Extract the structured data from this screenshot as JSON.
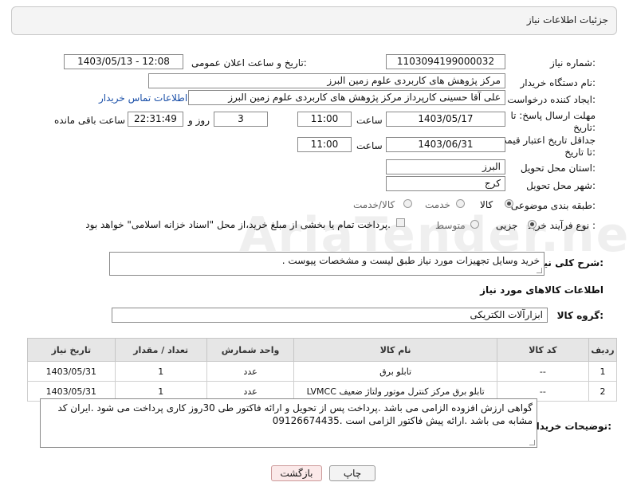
{
  "header": {
    "title": "جزئیات اطلاعات نیاز"
  },
  "watermark": "AriaTender.neT",
  "fields": {
    "need_number_label": "شماره نیاز:",
    "need_number": "1103094199000032",
    "announce_label": "تاریخ و ساعت اعلان عمومی:",
    "announce_value": "1403/05/13 - 12:08",
    "buyer_label": "نام دستگاه خریدار:",
    "buyer_value": "مرکز پژوهش های کاربردی علوم زمین البرز",
    "creator_label": "ایجاد کننده درخواست:",
    "creator_value": "علی آقا حسینی کارپرداز مرکز پژوهش های کاربردی علوم زمین البرز",
    "contact_link": "اطلاعات تماس خریدار",
    "deadline_label": "مهلت ارسال پاسخ: تا تاریخ:",
    "deadline_date": "1403/05/17",
    "hour_label": "ساعت",
    "deadline_time": "11:00",
    "days_value": "3",
    "days_label": "روز و",
    "remaining_value": "22:31:49",
    "remaining_label": "ساعت باقی مانده",
    "validity_label": "جداقل تاریخ اعتبار قیمت: تا تاریخ:",
    "validity_date": "1403/06/31",
    "validity_time": "11:00",
    "province_label": "استان محل تحویل:",
    "province_value": "البرز",
    "city_label": "شهر محل تحویل:",
    "city_value": "کرج",
    "category_label": "طبقه بندی موضوعی:",
    "category_options": [
      "کالا",
      "خدمت",
      "کالا/خدمت"
    ],
    "process_label": "نوع فرآیند خرید :",
    "process_options": [
      "جزیی",
      "متوسط"
    ],
    "payment_note": "پرداخت تمام یا بخشی از مبلغ خرید،از محل \"اسناد خزانه اسلامی\" خواهد بود."
  },
  "description": {
    "label": "شرح کلی نیاز:",
    "value": "خرید وسایل تجهیزات مورد نیاز طبق لیست و مشخصات پیوست ."
  },
  "goods": {
    "section_title": "اطلاعات کالاهای مورد نیاز",
    "group_label": "گروه کالا:",
    "group_value": "ابزارآلات الکتریکی",
    "columns": [
      "ردیف",
      "کد کالا",
      "نام کالا",
      "واحد شمارش",
      "تعداد / مقدار",
      "تاریخ نیاز"
    ],
    "rows": [
      [
        "1",
        "--",
        "تابلو برق",
        "عدد",
        "1",
        "1403/05/31"
      ],
      [
        "2",
        "--",
        "تابلو برق مرکز کنترل موتور ولتاژ ضعیف LVMCC",
        "عدد",
        "1",
        "1403/05/31"
      ]
    ]
  },
  "buyer_notes": {
    "label": "توضیحات خریدار:",
    "value": "گواهی ارزش افزوده الزامی می باشد .پرداخت پس از تحویل  و ارائه فاکتور طی 30روز کاری پرداخت می شود .ایران کد مشابه می باشد .ارائه پیش فاکتور الزامی است .09126674435"
  },
  "buttons": {
    "print": "چاپ",
    "back": "بازگشت"
  }
}
